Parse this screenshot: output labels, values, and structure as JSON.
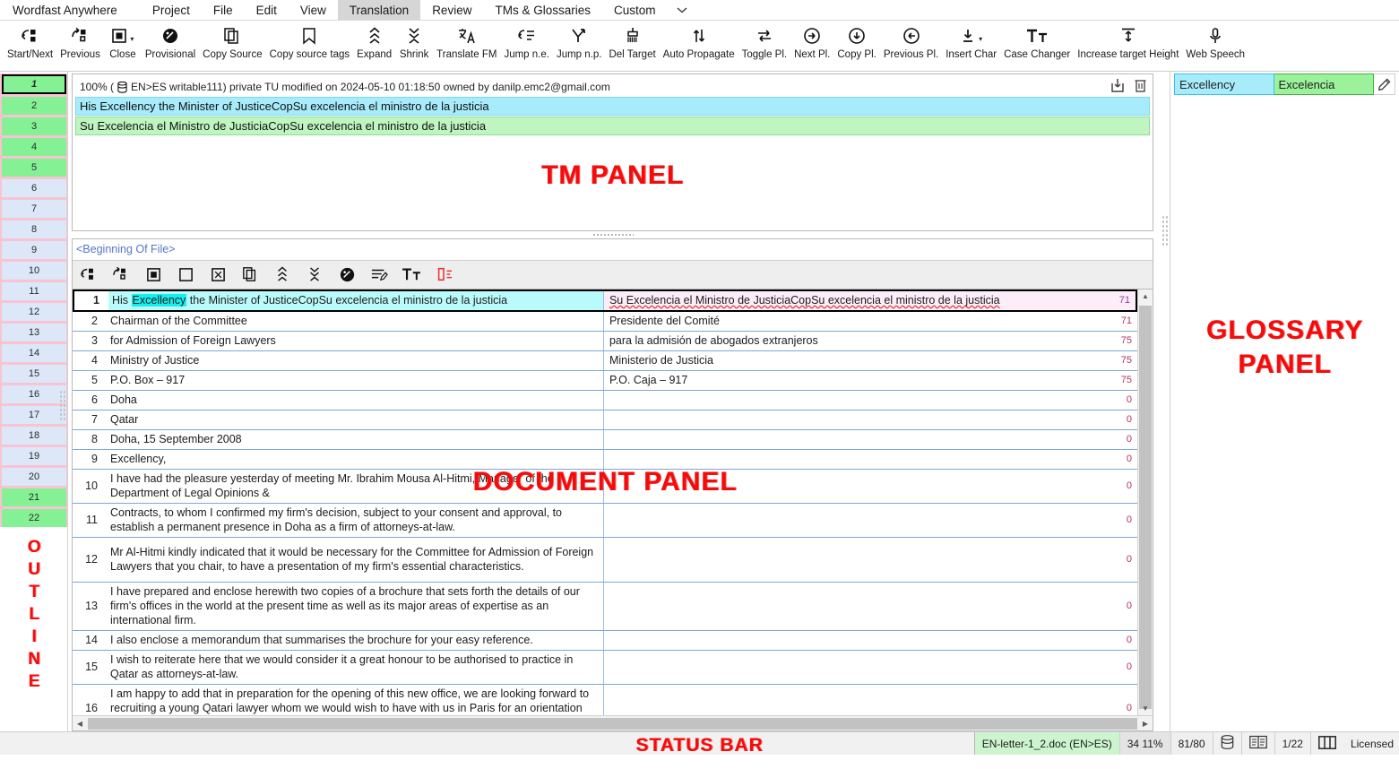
{
  "menu": {
    "items": [
      {
        "label": "Wordfast Anywhere",
        "active": false
      },
      {
        "label": "Project",
        "active": false
      },
      {
        "label": "File",
        "active": false
      },
      {
        "label": "Edit",
        "active": false
      },
      {
        "label": "View",
        "active": false
      },
      {
        "label": "Translation",
        "active": true
      },
      {
        "label": "Review",
        "active": false
      },
      {
        "label": "TMs & Glossaries",
        "active": false
      },
      {
        "label": "Custom",
        "active": false
      }
    ],
    "overflow_icon": "chevron-down-icon"
  },
  "ribbon": {
    "buttons": [
      {
        "label": "Start/Next",
        "icon": "start-next-icon",
        "caret": false
      },
      {
        "label": "Previous",
        "icon": "previous-segment-icon",
        "caret": false
      },
      {
        "label": "Close",
        "icon": "close-segment-icon",
        "caret": true
      },
      {
        "label": "Provisional",
        "icon": "provisional-icon",
        "caret": false
      },
      {
        "label": "Copy Source",
        "icon": "copy-source-icon",
        "caret": false
      },
      {
        "label": "Copy source tags",
        "icon": "copy-source-tags-icon",
        "caret": false
      },
      {
        "label": "Expand",
        "icon": "expand-icon",
        "caret": false
      },
      {
        "label": "Shrink",
        "icon": "shrink-icon",
        "caret": false
      },
      {
        "label": "Translate FM",
        "icon": "translate-fm-icon",
        "caret": false
      },
      {
        "label": "Jump n.e.",
        "icon": "jump-next-empty-icon",
        "caret": false
      },
      {
        "label": "Jump n.p.",
        "icon": "jump-next-provisional-icon",
        "caret": false
      },
      {
        "label": "Del Target",
        "icon": "delete-target-icon",
        "caret": false
      },
      {
        "label": "Auto Propagate",
        "icon": "auto-propagate-icon",
        "caret": false
      },
      {
        "label": "Toggle Pl.",
        "icon": "toggle-placeable-icon",
        "caret": false
      },
      {
        "label": "Next Pl.",
        "icon": "next-placeable-icon",
        "caret": false
      },
      {
        "label": "Copy Pl.",
        "icon": "copy-placeable-icon",
        "caret": false
      },
      {
        "label": "Previous Pl.",
        "icon": "previous-placeable-icon",
        "caret": false
      },
      {
        "label": "Insert Char",
        "icon": "insert-char-icon",
        "caret": true
      },
      {
        "label": "Case Changer",
        "icon": "case-changer-icon",
        "caret": false
      },
      {
        "label": "Increase target Height",
        "icon": "increase-target-height-icon",
        "caret": false
      },
      {
        "label": "Web Speech",
        "icon": "microphone-icon",
        "caret": false
      }
    ]
  },
  "outline": {
    "title": "OUTLINE",
    "segments": [
      {
        "num": "1",
        "state": "current"
      },
      {
        "num": "2",
        "state": "green"
      },
      {
        "num": "3",
        "state": "green"
      },
      {
        "num": "4",
        "state": "green"
      },
      {
        "num": "5",
        "state": "green"
      },
      {
        "num": "6",
        "state": "blue"
      },
      {
        "num": "7",
        "state": "blue"
      },
      {
        "num": "8",
        "state": "blue"
      },
      {
        "num": "9",
        "state": "blue"
      },
      {
        "num": "10",
        "state": "blue"
      },
      {
        "num": "11",
        "state": "blue"
      },
      {
        "num": "12",
        "state": "blue"
      },
      {
        "num": "13",
        "state": "blue"
      },
      {
        "num": "14",
        "state": "blue"
      },
      {
        "num": "15",
        "state": "blue"
      },
      {
        "num": "16",
        "state": "blue"
      },
      {
        "num": "17",
        "state": "blue"
      },
      {
        "num": "18",
        "state": "blue"
      },
      {
        "num": "19",
        "state": "blue"
      },
      {
        "num": "20",
        "state": "blue"
      },
      {
        "num": "21",
        "state": "green"
      },
      {
        "num": "22",
        "state": "green"
      }
    ]
  },
  "tm_panel": {
    "watermark": "TM PANEL",
    "match_percent": "100%",
    "meta_prefix": "100% (",
    "meta_tm": "EN>ES writable111) private TU modified on 2024-05-10 01:18:50 owned by danilp.emc2@gmail.com",
    "source": "His Excellency the Minister of JusticeCopSu excelencia el ministro de la justicia",
    "target": "Su Excelencia el Ministro de JusticiaCopSu excelencia el ministro de la justicia",
    "actions": [
      {
        "name": "download-tm-icon"
      },
      {
        "name": "delete-tm-icon"
      }
    ]
  },
  "document_panel": {
    "watermark": "DOCUMENT PANEL",
    "beginning_of_file": "<Beginning Of File>",
    "toolbar_icons": [
      "start-next-icon",
      "previous-segment-icon",
      "close-segment-icon",
      "empty-segment-icon",
      "delete-segment-icon",
      "copy-source-icon",
      "expand-icon",
      "shrink-icon",
      "provisional-icon",
      "edit-note-icon",
      "case-changer-icon",
      "clear-target-icon"
    ],
    "rows": [
      {
        "num": "1",
        "source_pre": "His ",
        "source_hl": "Excellency",
        "source_post": " the Minister of JusticeCopSu excelencia el ministro de la justicia",
        "target": "Su Excelencia el Ministro de JusticiaCopSu excelencia el ministro de la justicia",
        "score": "71",
        "current": true
      },
      {
        "num": "2",
        "source": "Chairman of the Committee",
        "target": "Presidente del Comité",
        "score": "71"
      },
      {
        "num": "3",
        "source": "for Admission of Foreign Lawyers",
        "target": "para la admisión de abogados extranjeros",
        "score": "75"
      },
      {
        "num": "4",
        "source": "Ministry of Justice",
        "target": "Ministerio de Justicia",
        "score": "75"
      },
      {
        "num": "5",
        "source": "P.O. Box – 917",
        "target": "P.O. Caja – 917",
        "score": "75"
      },
      {
        "num": "6",
        "source": "Doha",
        "target": "",
        "score": "0"
      },
      {
        "num": "7",
        "source": "Qatar",
        "target": "",
        "score": "0"
      },
      {
        "num": "8",
        "source": "Doha, 15 September 2008",
        "target": "",
        "score": "0"
      },
      {
        "num": "9",
        "source": "Excellency,",
        "target": "",
        "score": "0"
      },
      {
        "num": "10",
        "source": "I have had the pleasure yesterday of meeting Mr. Ibrahim Mousa Al-Hitmi, Manager of the Department of Legal Opinions &",
        "target": "",
        "score": "0"
      },
      {
        "num": "11",
        "source": "Contracts, to whom I confirmed my firm's decision, subject to your consent and approval, to establish a permanent presence in Doha as a firm of attorneys-at-law.",
        "target": "",
        "score": "0"
      },
      {
        "num": "12",
        "source": "Mr Al-Hitmi kindly indicated that it would be necessary for the Committee for Admission of Foreign Lawyers that you chair, to have a presentation of my firm's essential characteristics.",
        "target": "",
        "score": "0"
      },
      {
        "num": "13",
        "source": "I have prepared and enclose herewith two copies of a brochure that sets forth the details of our firm's offices in the world at the present time as well as its major areas of expertise as an international firm.",
        "target": "",
        "score": "0"
      },
      {
        "num": "14",
        "source": "I also enclose a memorandum that summarises the brochure for your easy reference.",
        "target": "",
        "score": "0"
      },
      {
        "num": "15",
        "source": "I wish to reiterate here that we would consider it a great honour to be authorised to practice in Qatar as attorneys-at-law.",
        "target": "",
        "score": "0"
      },
      {
        "num": "16",
        "source": "I am happy to add that in preparation for the opening of this new office, we are looking forward to recruiting a young Qatari lawyer whom we would wish to have with us in Paris for an orientation period before he becomes a member of our new team in Doha.",
        "target": "",
        "score": "0"
      }
    ]
  },
  "glossary_panel": {
    "watermark_line1": "GLOSSARY",
    "watermark_line2": "PANEL",
    "entries": [
      {
        "source": "Excellency",
        "target": "Excelencia",
        "edit_icon": "pencil-edit-icon"
      }
    ]
  },
  "status_bar": {
    "watermark": "STATUS BAR",
    "filename": "EN-letter-1_2.doc (EN>ES)",
    "progress": "34 11%",
    "words": "81/80",
    "tm_icon": "database-icon",
    "glossary_icon": "glossary-book-icon",
    "segment_position": "1/22",
    "layout_icon": "columns-layout-icon",
    "license": "Licensed"
  },
  "colors": {
    "accent_red": "#f30c0c",
    "source_highlight": "#14f0f0",
    "tm_source_bg": "#a8ecfb",
    "tm_target_bg": "#bff5c0",
    "outline_green": "#84f194",
    "outline_blue": "#dce7f7",
    "outline_strip": "#f9c3d2",
    "score_color": "#b0335a"
  }
}
